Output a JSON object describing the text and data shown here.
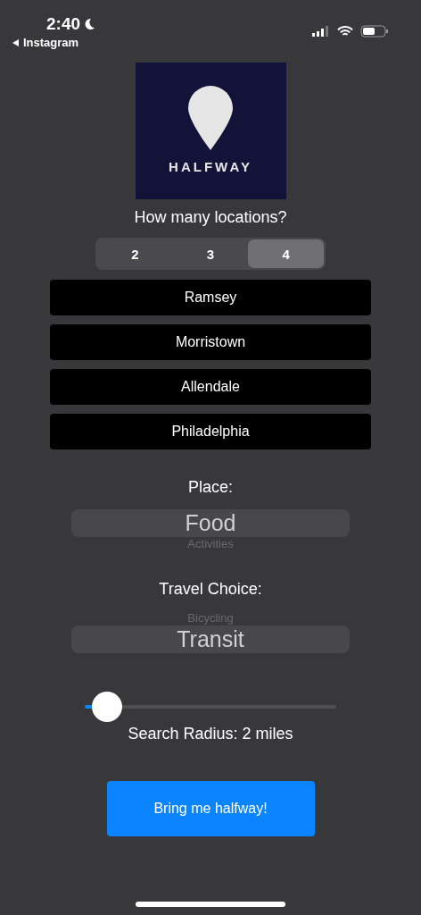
{
  "status_bar": {
    "time": "2:40",
    "back_app": "Instagram"
  },
  "logo": {
    "wordmark": "HALFWAY"
  },
  "locations": {
    "question": "How many locations?",
    "options": [
      {
        "label": "2",
        "selected": false
      },
      {
        "label": "3",
        "selected": false
      },
      {
        "label": "4",
        "selected": true
      }
    ],
    "fields": [
      {
        "value": "Ramsey"
      },
      {
        "value": "Morristown"
      },
      {
        "value": "Allendale"
      },
      {
        "value": "Philadelphia"
      }
    ]
  },
  "place": {
    "label": "Place:",
    "items": [
      {
        "label": "Food",
        "selected": true
      },
      {
        "label": "Activities",
        "selected": false
      }
    ]
  },
  "travel": {
    "label": "Travel Choice:",
    "items": [
      {
        "label": "Bicycling",
        "selected": false
      },
      {
        "label": "Transit",
        "selected": true
      }
    ]
  },
  "radius": {
    "level": 0.09,
    "reading": "Search Radius: 2 miles"
  },
  "submit": {
    "label": "Bring me halfway!"
  }
}
